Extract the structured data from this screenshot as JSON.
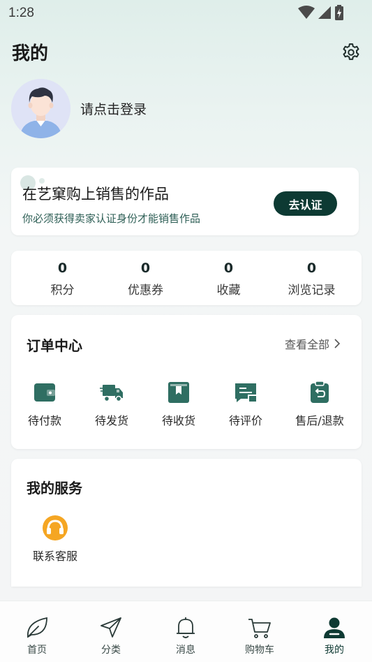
{
  "status_bar": {
    "time": "1:28"
  },
  "header": {
    "title": "我的",
    "settings_icon": "gear-icon"
  },
  "profile": {
    "login_prompt": "请点击登录"
  },
  "seller": {
    "title": "在艺窠购上销售的作品",
    "subtitle": "你必须获得卖家认证身份才能销售作品",
    "button_label": "去认证"
  },
  "stats": [
    {
      "value": "0",
      "label": "积分"
    },
    {
      "value": "0",
      "label": "优惠券"
    },
    {
      "value": "0",
      "label": "收藏"
    },
    {
      "value": "0",
      "label": "浏览记录"
    }
  ],
  "orders": {
    "title": "订单中心",
    "view_all": "查看全部",
    "items": [
      {
        "label": "待付款",
        "icon": "wallet-icon"
      },
      {
        "label": "待发货",
        "icon": "truck-icon"
      },
      {
        "label": "待收货",
        "icon": "box-icon"
      },
      {
        "label": "待评价",
        "icon": "review-icon"
      },
      {
        "label": "售后/退款",
        "icon": "refund-icon"
      }
    ]
  },
  "services": {
    "title": "我的服务",
    "items": [
      {
        "label": "联系客服",
        "icon": "headset-icon"
      }
    ]
  },
  "tab_bar": {
    "items": [
      {
        "label": "首页",
        "icon": "leaf-icon"
      },
      {
        "label": "分类",
        "icon": "send-icon"
      },
      {
        "label": "消息",
        "icon": "bell-icon"
      },
      {
        "label": "购物车",
        "icon": "cart-icon"
      },
      {
        "label": "我的",
        "icon": "user-icon"
      }
    ],
    "active": "我的"
  },
  "colors": {
    "brand_dark": "#0d3a33",
    "accent_green": "#2f6e62",
    "service_orange": "#f5a623"
  }
}
